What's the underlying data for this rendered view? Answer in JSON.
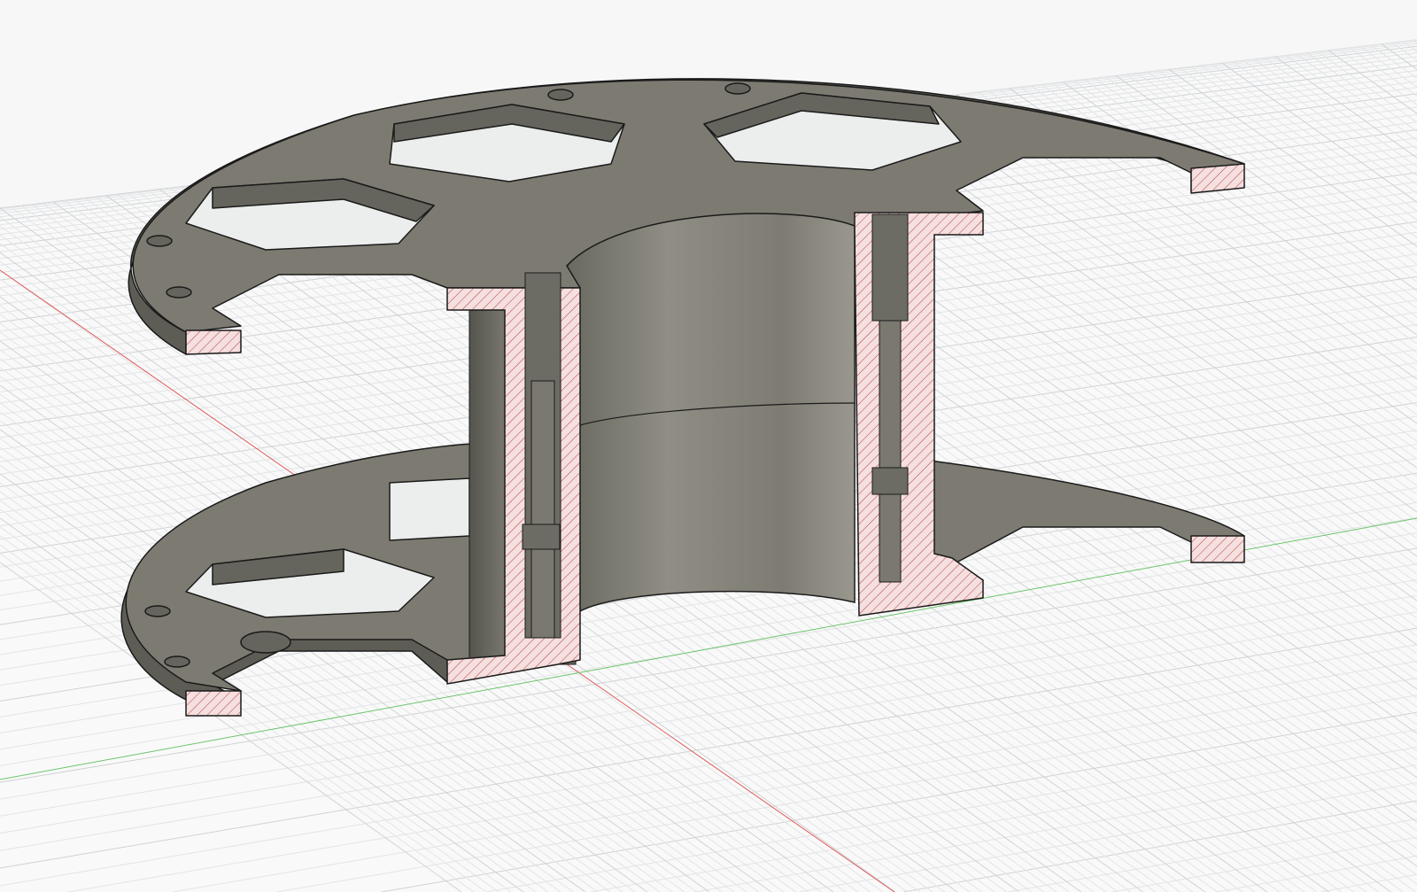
{
  "viewport": {
    "colors": {
      "background": "#f7f7f7",
      "grid_minor": "#e2e4e6",
      "grid_major": "#cfd2d5",
      "x_axis": "#e05a5a",
      "y_axis": "#6cc46c",
      "body_top": "#7d7b71",
      "body_side": "#5e5d55",
      "section_fill": "#f5dfdf",
      "section_hatch": "#b04040",
      "edge": "#1a1a1a"
    }
  }
}
